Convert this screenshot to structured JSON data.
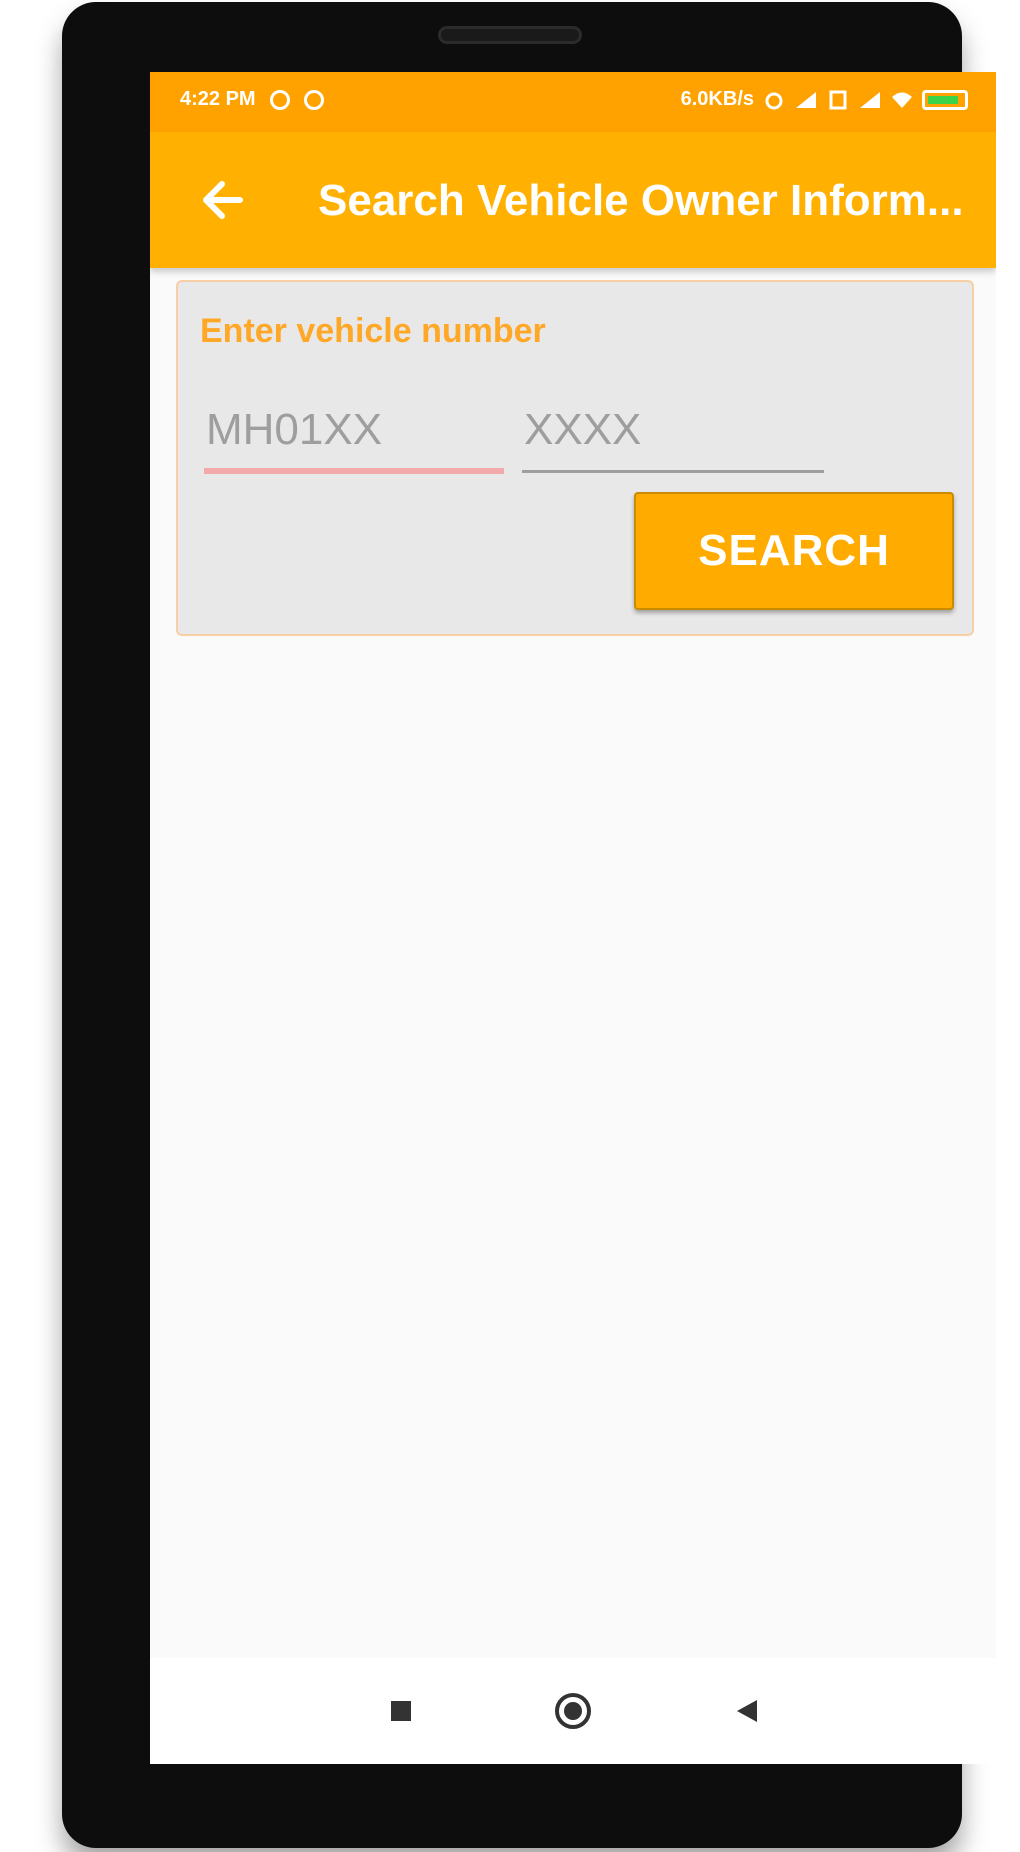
{
  "status_bar": {
    "time": "4:22 PM",
    "network_speed": "6.0KB/s",
    "left_icons": [
      "notification-icon",
      "notification-icon"
    ],
    "right_icons": [
      "alarm-icon",
      "signal-icon",
      "sim-icon",
      "signal-icon",
      "wifi-icon",
      "battery-icon"
    ]
  },
  "app_bar": {
    "title": "Search Vehicle Owner Inform...",
    "back_icon": "arrow-left-icon",
    "background": "#ffb000"
  },
  "search_form": {
    "label": "Enter vehicle number",
    "state_code_input": {
      "value": "",
      "placeholder": "MH01XX"
    },
    "number_input": {
      "value": "",
      "placeholder": "XXXX"
    },
    "search_button_label": "SEARCH"
  },
  "navigation": {
    "buttons": [
      "recents-square-icon",
      "home-circle-icon",
      "back-triangle-icon"
    ]
  },
  "colors": {
    "status_bar": "#ffa200",
    "accent": "#ffab00",
    "label": "#ffa726",
    "error_underline": "#f2a9a9"
  }
}
